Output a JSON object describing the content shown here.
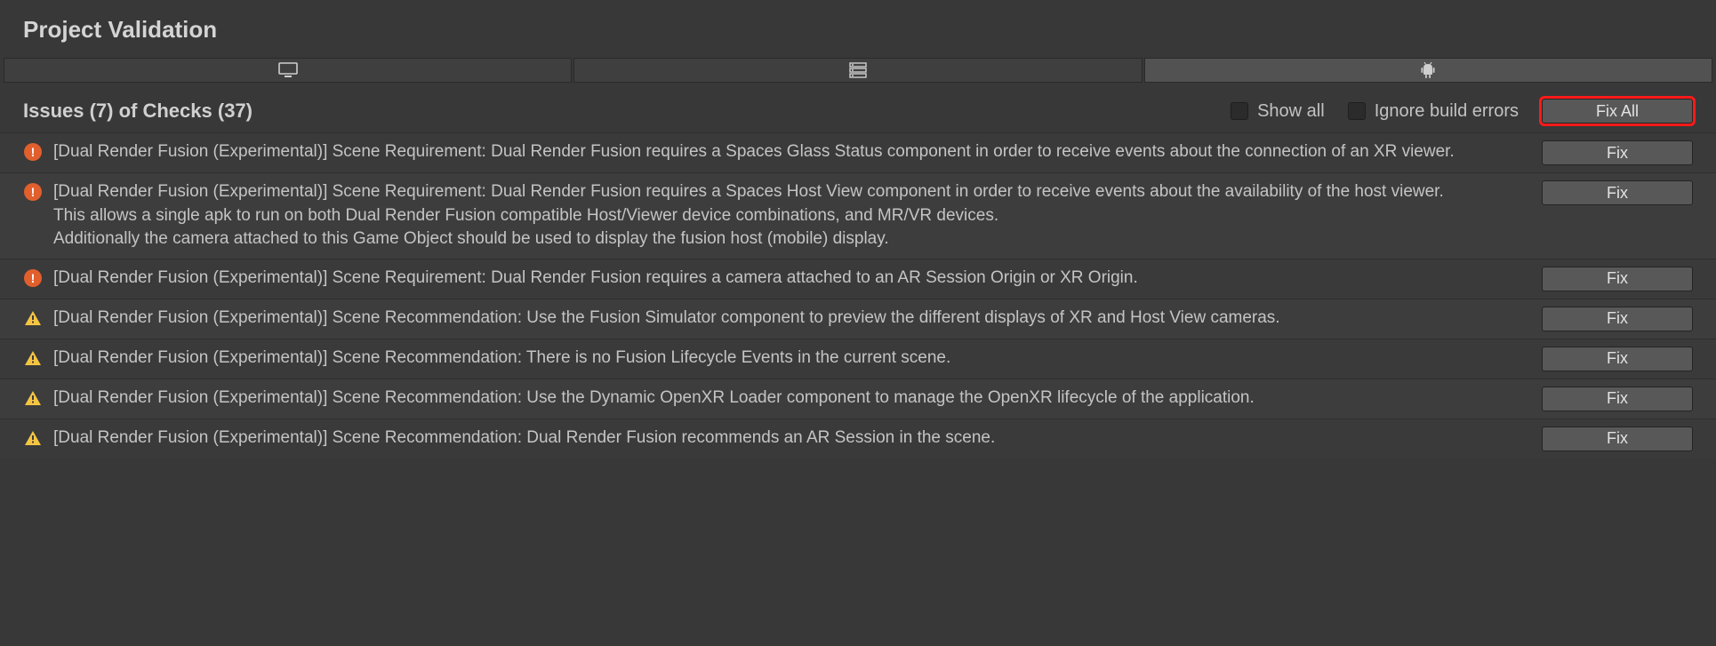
{
  "title": "Project Validation",
  "tabs": [
    {
      "id": "desktop",
      "icon": "monitor-icon",
      "active": false
    },
    {
      "id": "server",
      "icon": "server-icon",
      "active": false
    },
    {
      "id": "android",
      "icon": "android-icon",
      "active": true
    }
  ],
  "toolbar": {
    "heading": "Issues (7) of Checks (37)",
    "show_all_label": "Show all",
    "ignore_errors_label": "Ignore build errors",
    "fix_all_label": "Fix All",
    "fix_label": "Fix"
  },
  "issues": [
    {
      "severity": "error",
      "text": "[Dual Render Fusion (Experimental)] Scene Requirement: Dual Render Fusion requires a Spaces Glass Status component in order to receive events about the connection of an XR viewer."
    },
    {
      "severity": "error",
      "text": "[Dual Render Fusion (Experimental)] Scene Requirement: Dual Render Fusion requires a Spaces Host View component in order to receive events about the availability of the host viewer.\nThis allows a single apk to run on both Dual Render Fusion compatible Host/Viewer device combinations, and MR/VR devices.\nAdditionally the camera attached to this Game Object should be used to display the fusion host (mobile) display."
    },
    {
      "severity": "error",
      "text": "[Dual Render Fusion (Experimental)] Scene Requirement: Dual Render Fusion requires a camera attached to an AR Session Origin or XR Origin."
    },
    {
      "severity": "warning",
      "text": "[Dual Render Fusion (Experimental)] Scene Recommendation: Use the Fusion Simulator component to preview the different displays of XR and Host View cameras."
    },
    {
      "severity": "warning",
      "text": "[Dual Render Fusion (Experimental)] Scene Recommendation: There is no Fusion Lifecycle Events in the current scene."
    },
    {
      "severity": "warning",
      "text": "[Dual Render Fusion (Experimental)] Scene Recommendation: Use the Dynamic OpenXR Loader component to manage the OpenXR lifecycle of the application."
    },
    {
      "severity": "warning",
      "text": "[Dual Render Fusion (Experimental)] Scene Recommendation: Dual Render Fusion recommends an AR Session in the scene."
    }
  ],
  "colors": {
    "error": "#e15f2c",
    "warning": "#f5c542",
    "highlight": "#ff1a1a"
  }
}
